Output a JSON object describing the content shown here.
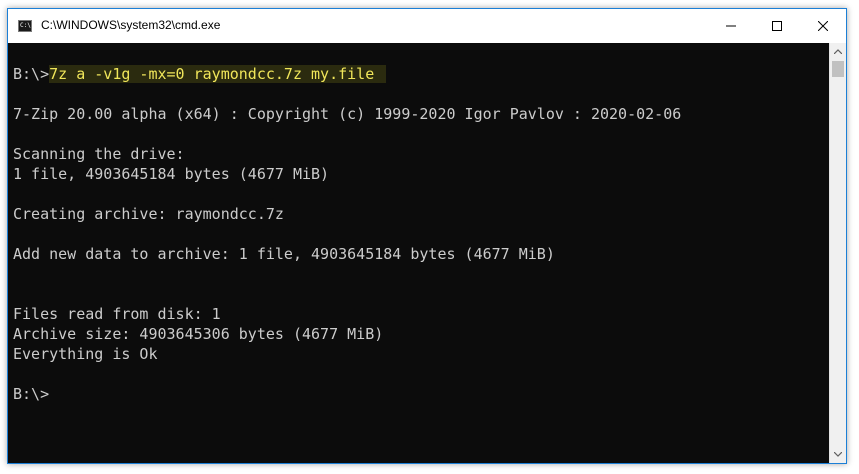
{
  "window": {
    "title": "C:\\WINDOWS\\system32\\cmd.exe",
    "icon_text": "C:\\",
    "controls": [
      "minimize-icon",
      "maximize-icon",
      "close-icon"
    ]
  },
  "console": {
    "prompt": "B:\\>",
    "command": "7z a -v1g -mx=0 raymondcc.7z my.file",
    "lines": [
      "7-Zip 20.00 alpha (x64) : Copyright (c) 1999-2020 Igor Pavlov : 2020-02-06",
      "Scanning the drive:",
      "1 file, 4903645184 bytes (4677 MiB)",
      "Creating archive: raymondcc.7z",
      "Add new data to archive: 1 file, 4903645184 bytes (4677 MiB)",
      "Files read from disk: 1",
      "Archive size: 4903645306 bytes (4677 MiB)",
      "Everything is Ok",
      "B:\\>"
    ]
  },
  "colors": {
    "console_bg": "#0c0c0c",
    "console_text": "#cccccc",
    "command_highlight_text": "#f0e65a",
    "command_highlight_bg": "#2b2b0f",
    "window_border": "#1b7fd6"
  }
}
